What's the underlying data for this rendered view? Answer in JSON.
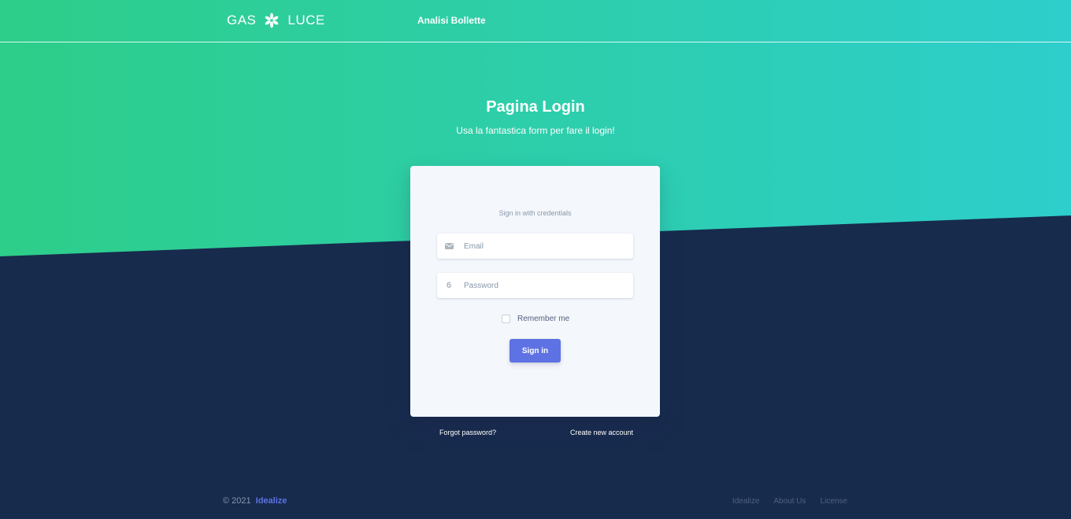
{
  "navbar": {
    "brand_left": "GAS",
    "brand_right": "LUCE",
    "brand_icon": "asterisk-flower-icon",
    "link": "Analisi Bollette"
  },
  "hero": {
    "title": "Pagina Login",
    "subtitle": "Usa la fantastica form per fare il login!"
  },
  "card": {
    "caption": "Sign in with credentials",
    "email_placeholder": "Email",
    "email_icon": "envelope-icon",
    "password_placeholder": "Password",
    "password_icon": "lock-icon",
    "password_icon_glyph": "6",
    "remember_label": "Remember me",
    "signin_label": "Sign in"
  },
  "links": {
    "forgot": "Forgot password?",
    "create": "Create new account"
  },
  "footer": {
    "copyright": "© 2021",
    "brand": "Idealize",
    "links": [
      "Idealize",
      "About Us",
      "License"
    ]
  },
  "colors": {
    "gradient_start": "#2dce89",
    "gradient_end": "#2dcecc",
    "background": "#172b4d",
    "primary": "#5e72e4"
  }
}
